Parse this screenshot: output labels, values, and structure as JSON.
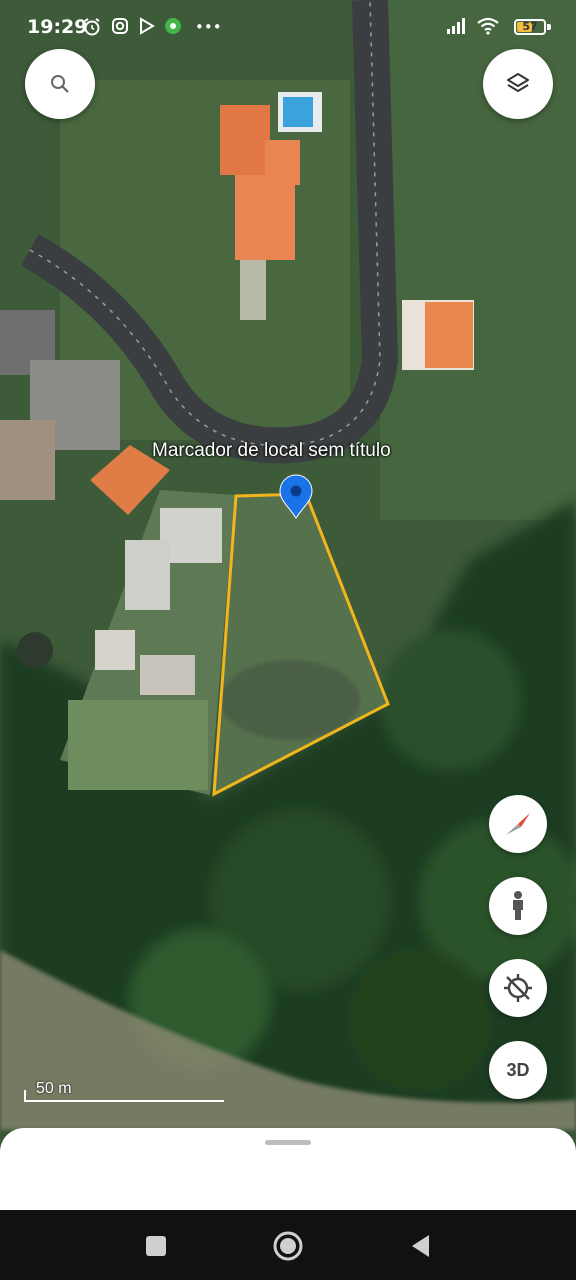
{
  "status_bar": {
    "time": "19:29",
    "battery": "57",
    "battery_level": 0.57,
    "notification_icons": [
      "alarm-icon",
      "instagram-icon",
      "play-icon",
      "app-badge-icon",
      "more-dots-icon"
    ],
    "system_icons": [
      "signal-icon",
      "wifi-icon",
      "battery-icon"
    ],
    "more": "•••"
  },
  "map": {
    "placemark_label": "Marcador de local sem título",
    "scale_label": "50 m",
    "polygon_color": "#f2b51c",
    "pin_color": "#1a73e8"
  },
  "controls": {
    "search_icon": "search-icon",
    "layers_icon": "layers-icon",
    "compass_icon": "compass-icon",
    "street_view_icon": "pegman-icon",
    "location_icon": "location-off-icon",
    "three_d_label": "3D"
  },
  "nav": [
    "recents-icon",
    "home-icon",
    "back-icon"
  ]
}
